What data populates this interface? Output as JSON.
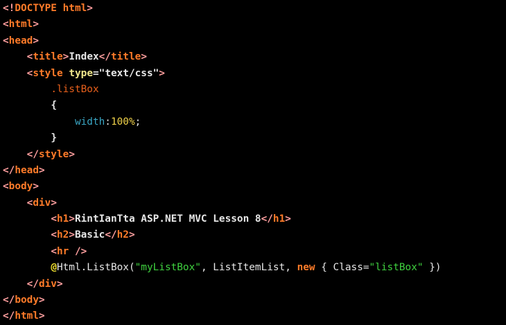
{
  "editor": {
    "colors": {
      "background": "#000000",
      "bracket": "#ff9f9f",
      "tag": "#ff7b29",
      "attribute": "#f0e68c",
      "string": "#3fd13f",
      "selector": "#e8601c",
      "property": "#3aa6c4",
      "value": "#f0d24a",
      "plain": "#e6e6e6",
      "keyword": "#ff7b29",
      "razor": "#f0e030"
    },
    "lines": [
      [
        {
          "t": "<!",
          "c": "bracket"
        },
        {
          "t": "DOCTYPE html",
          "c": "tag"
        },
        {
          "t": ">",
          "c": "bracket"
        }
      ],
      [
        {
          "t": "<",
          "c": "bracket"
        },
        {
          "t": "html",
          "c": "tag"
        },
        {
          "t": ">",
          "c": "bracket"
        }
      ],
      [
        {
          "t": "<",
          "c": "bracket"
        },
        {
          "t": "head",
          "c": "tag"
        },
        {
          "t": ">",
          "c": "bracket"
        }
      ],
      [
        {
          "t": "    ",
          "c": "plain"
        },
        {
          "t": "<",
          "c": "bracket"
        },
        {
          "t": "title",
          "c": "tag"
        },
        {
          "t": ">",
          "c": "bracket"
        },
        {
          "t": "Index",
          "c": "plain"
        },
        {
          "t": "</",
          "c": "bracket"
        },
        {
          "t": "title",
          "c": "tag"
        },
        {
          "t": ">",
          "c": "bracket"
        }
      ],
      [
        {
          "t": "    ",
          "c": "plain"
        },
        {
          "t": "<",
          "c": "bracket"
        },
        {
          "t": "style",
          "c": "tag"
        },
        {
          "t": " ",
          "c": "plain"
        },
        {
          "t": "type",
          "c": "attribute"
        },
        {
          "t": "=",
          "c": "plain"
        },
        {
          "t": "\"text/css\"",
          "c": "plain"
        },
        {
          "t": ">",
          "c": "bracket"
        }
      ],
      [
        {
          "t": "        ",
          "c": "plain"
        },
        {
          "t": ".listBox",
          "c": "selector",
          "w": "n"
        }
      ],
      [
        {
          "t": "        ",
          "c": "plain"
        },
        {
          "t": "{",
          "c": "plain"
        }
      ],
      [
        {
          "t": "            ",
          "c": "plain"
        },
        {
          "t": "width",
          "c": "property",
          "w": "n"
        },
        {
          "t": ":",
          "c": "plain",
          "w": "n"
        },
        {
          "t": "100%",
          "c": "value",
          "w": "n"
        },
        {
          "t": ";",
          "c": "plain",
          "w": "n"
        }
      ],
      [
        {
          "t": "        ",
          "c": "plain"
        },
        {
          "t": "}",
          "c": "plain"
        }
      ],
      [
        {
          "t": "    ",
          "c": "plain"
        },
        {
          "t": "</",
          "c": "bracket"
        },
        {
          "t": "style",
          "c": "tag"
        },
        {
          "t": ">",
          "c": "bracket"
        }
      ],
      [
        {
          "t": "</",
          "c": "bracket"
        },
        {
          "t": "head",
          "c": "tag"
        },
        {
          "t": ">",
          "c": "bracket"
        }
      ],
      [
        {
          "t": "<",
          "c": "bracket"
        },
        {
          "t": "body",
          "c": "tag"
        },
        {
          "t": ">",
          "c": "bracket"
        }
      ],
      [
        {
          "t": "    ",
          "c": "plain"
        },
        {
          "t": "<",
          "c": "bracket"
        },
        {
          "t": "div",
          "c": "tag"
        },
        {
          "t": ">",
          "c": "bracket"
        }
      ],
      [
        {
          "t": "        ",
          "c": "plain"
        },
        {
          "t": "<",
          "c": "bracket"
        },
        {
          "t": "h1",
          "c": "tag"
        },
        {
          "t": ">",
          "c": "bracket"
        },
        {
          "t": "RintIanTta ASP.NET MVC Lesson 8",
          "c": "plain"
        },
        {
          "t": "</",
          "c": "bracket"
        },
        {
          "t": "h1",
          "c": "tag"
        },
        {
          "t": ">",
          "c": "bracket"
        }
      ],
      [
        {
          "t": "        ",
          "c": "plain"
        },
        {
          "t": "<",
          "c": "bracket"
        },
        {
          "t": "h2",
          "c": "tag"
        },
        {
          "t": ">",
          "c": "bracket"
        },
        {
          "t": "Basic",
          "c": "plain"
        },
        {
          "t": "</",
          "c": "bracket"
        },
        {
          "t": "h2",
          "c": "tag"
        },
        {
          "t": ">",
          "c": "bracket"
        }
      ],
      [
        {
          "t": "        ",
          "c": "plain"
        },
        {
          "t": "<",
          "c": "bracket"
        },
        {
          "t": "hr",
          "c": "tag"
        },
        {
          "t": " />",
          "c": "bracket"
        }
      ],
      [
        {
          "t": "        ",
          "c": "plain"
        },
        {
          "t": "@",
          "c": "razor"
        },
        {
          "t": "Html.ListBox(",
          "c": "plain",
          "w": "n"
        },
        {
          "t": "\"myListBox\"",
          "c": "string",
          "w": "n"
        },
        {
          "t": ", ListItemList, ",
          "c": "plain",
          "w": "n"
        },
        {
          "t": "new",
          "c": "keyword"
        },
        {
          "t": " { Class=",
          "c": "plain",
          "w": "n"
        },
        {
          "t": "\"listBox\"",
          "c": "string",
          "w": "n"
        },
        {
          "t": " })",
          "c": "plain",
          "w": "n"
        }
      ],
      [
        {
          "t": "    ",
          "c": "plain"
        },
        {
          "t": "</",
          "c": "bracket"
        },
        {
          "t": "div",
          "c": "tag"
        },
        {
          "t": ">",
          "c": "bracket"
        }
      ],
      [
        {
          "t": "</",
          "c": "bracket"
        },
        {
          "t": "body",
          "c": "tag"
        },
        {
          "t": ">",
          "c": "bracket"
        }
      ],
      [
        {
          "t": "</",
          "c": "bracket"
        },
        {
          "t": "html",
          "c": "tag"
        },
        {
          "t": ">",
          "c": "bracket"
        }
      ]
    ]
  }
}
